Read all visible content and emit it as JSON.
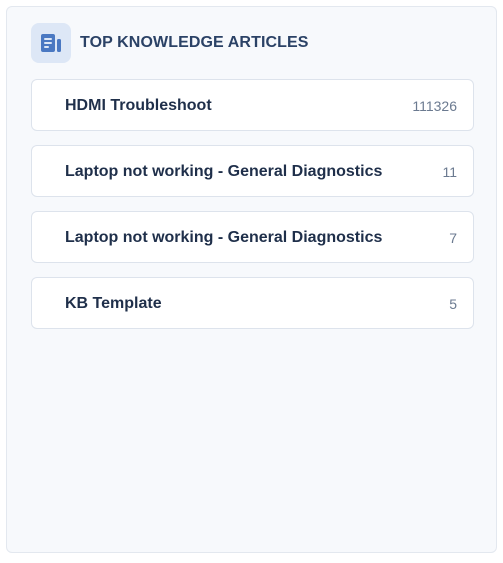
{
  "widget": {
    "title": "TOP KNOWLEDGE ARTICLES",
    "icon": "article-icon",
    "accent_color": "#2b4266",
    "icon_bg_color": "#dde7f6"
  },
  "articles": [
    {
      "title": "HDMI Troubleshoot",
      "count": "111326"
    },
    {
      "title": "Laptop not working - General Diagnostics",
      "count": "11"
    },
    {
      "title": "Laptop not working - General Diagnostics",
      "count": "7"
    },
    {
      "title": "KB Template",
      "count": "5"
    }
  ]
}
